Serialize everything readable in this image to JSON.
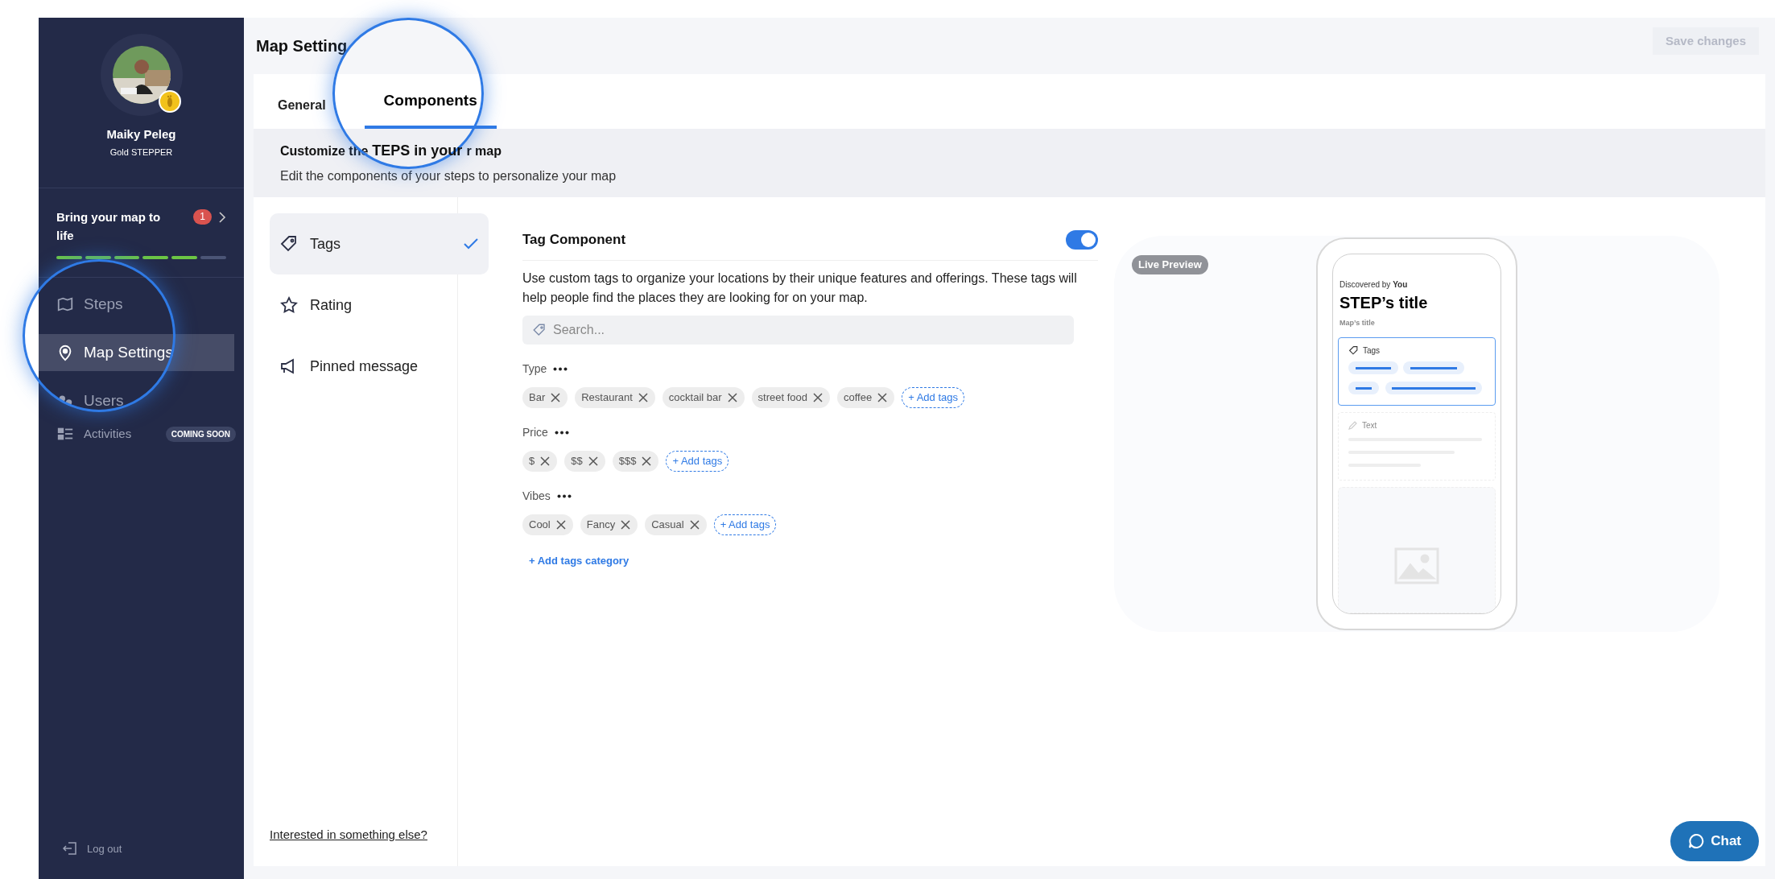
{
  "sidebar": {
    "user": {
      "name": "Maiky Peleg",
      "level": "Gold STEPPER"
    },
    "promo": {
      "title": "Bring your map to life",
      "count": "1",
      "segments": [
        {
          "done": true
        },
        {
          "done": true
        },
        {
          "done": true
        },
        {
          "done": true
        },
        {
          "done": true
        },
        {
          "done": false
        }
      ]
    },
    "items": [
      {
        "label": "Steps",
        "kind": "steps",
        "selected": false
      },
      {
        "label": "Map Settings",
        "kind": "settings",
        "selected": true
      },
      {
        "label": "Users",
        "kind": "users",
        "selected": false
      },
      {
        "label": "Activities",
        "kind": "activities",
        "selected": false,
        "badge": "COMING SOON"
      }
    ],
    "logout": "Log out"
  },
  "header": {
    "title": "Map Setting",
    "save": "Save changes"
  },
  "tabs": [
    {
      "label": "General",
      "selected": false
    },
    {
      "label": "Components",
      "selected": true
    }
  ],
  "intro": {
    "heading_parts": [
      "Customize the",
      "TEPS in your",
      "r map"
    ],
    "subtitle": "Edit the components of your steps to personalize your map"
  },
  "components": [
    {
      "label": "Tags",
      "kind": "tag",
      "selected": true
    },
    {
      "label": "Rating",
      "kind": "star",
      "selected": false
    },
    {
      "label": "Pinned message",
      "kind": "megaphone",
      "selected": false
    }
  ],
  "other_link": "Interested in something else?",
  "editor": {
    "title": "Tag Component",
    "on": true,
    "description": "Use custom tags to organize your locations by their unique features and offerings. These tags will help people find the places they are looking for on your map.",
    "search": {
      "placeholder": "Search..."
    },
    "groups": [
      {
        "name": "Type",
        "tags": [
          "Bar",
          "Restaurant",
          "cocktail bar",
          "street food",
          "coffee"
        ],
        "add": "+ Add tags"
      },
      {
        "name": "Price",
        "tags": [
          "$",
          "$$",
          "$$$"
        ],
        "add": "+ Add tags"
      },
      {
        "name": "Vibes",
        "tags": [
          "Cool",
          "Fancy",
          "Casual"
        ],
        "add": "+ Add tags"
      }
    ],
    "add_category": "+ Add tags category"
  },
  "preview": {
    "badge": "Live Preview",
    "discovered": "Discovered by **You**",
    "step_title": "STEP’s title",
    "map_title": "Map’s title",
    "tags_label": "Tags",
    "text_label": "Text"
  },
  "chat": "Chat"
}
